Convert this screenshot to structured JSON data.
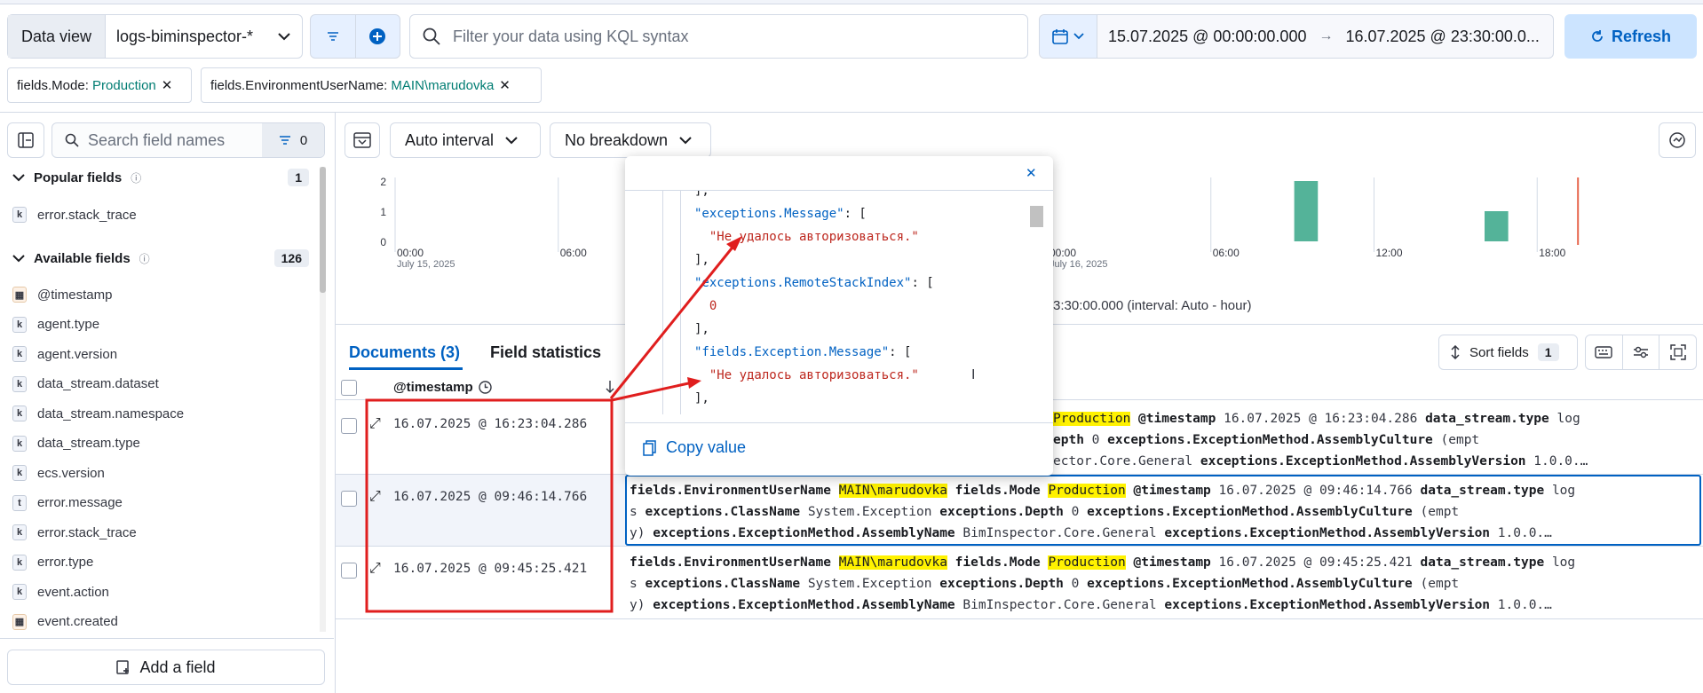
{
  "header": {
    "data_view_label": "Data view",
    "data_view_value": "logs-biminspector-*",
    "kql_placeholder": "Filter your data using KQL syntax",
    "date_start": "15.07.2025 @ 00:00:00.000",
    "date_end": "16.07.2025 @ 23:30:00.0...",
    "refresh_label": "Refresh"
  },
  "filters": [
    {
      "key": "fields.Mode: ",
      "value": "Production"
    },
    {
      "key": "fields.EnvironmentUserName: ",
      "value": "MAIN\\marudovka"
    }
  ],
  "sidebar": {
    "search_placeholder": "Search field names",
    "filter_count": "0",
    "popular_title": "Popular fields",
    "popular_count": "1",
    "popular_items": [
      {
        "type": "k",
        "label": "error.stack_trace"
      }
    ],
    "available_title": "Available fields",
    "available_count": "126",
    "available_items": [
      {
        "type": "date",
        "label": "@timestamp"
      },
      {
        "type": "k",
        "label": "agent.type"
      },
      {
        "type": "k",
        "label": "agent.version"
      },
      {
        "type": "k",
        "label": "data_stream.dataset"
      },
      {
        "type": "k",
        "label": "data_stream.namespace"
      },
      {
        "type": "k",
        "label": "data_stream.type"
      },
      {
        "type": "k",
        "label": "ecs.version"
      },
      {
        "type": "t",
        "label": "error.message"
      },
      {
        "type": "k",
        "label": "error.stack_trace"
      },
      {
        "type": "k",
        "label": "error.type"
      },
      {
        "type": "k",
        "label": "event.action"
      },
      {
        "type": "date",
        "label": "event.created"
      }
    ],
    "add_field_label": "Add a field"
  },
  "toolbar": {
    "interval_label": "Auto interval",
    "breakdown_label": "No breakdown"
  },
  "chart_data": {
    "type": "bar",
    "ylim": [
      0,
      2
    ],
    "y_ticks": [
      "2",
      "1",
      "0"
    ],
    "x_ticks": [
      "00:00",
      "06:00",
      "00:00",
      "06:00",
      "12:00",
      "18:00"
    ],
    "x_tick_sub": [
      "July 15, 2025",
      "July 16, 2025"
    ],
    "bars": [
      {
        "time": "16.07.2025 09:00",
        "value": 2
      },
      {
        "time": "16.07.2025 16:00",
        "value": 1
      }
    ],
    "marker": "now",
    "caption": "3:30:00.000 (interval: Auto - hour)"
  },
  "tabs": {
    "documents": "Documents (3)",
    "field_stats": "Field statistics"
  },
  "table": {
    "timestamp_header": "@timestamp",
    "sort_label": "Sort fields",
    "sort_count": "1",
    "rows": [
      {
        "ts": "16.07.2025 @ 16:23:04.286",
        "l1": [
          "Production",
          "@timestamp",
          "16.07.2025 @ 16:23:04.286",
          "data_stream.type",
          "log"
        ],
        "l2": [
          "epth",
          "0",
          "exceptions.ExceptionMethod.AssemblyCulture",
          "(empt"
        ],
        "l3": [
          "ector.Core.General",
          "exceptions.ExceptionMethod.AssemblyVersion",
          "1.0.0.…"
        ]
      },
      {
        "ts": "16.07.2025 @ 09:46:14.766"
      },
      {
        "ts": "16.07.2025 @ 09:45:25.421"
      }
    ],
    "full_rows": [
      {
        "user": "MAIN\\marudovka",
        "mode": "Production",
        "ts": "16.07.2025 @ 09:46:14.766"
      },
      {
        "user": "MAIN\\marudovka",
        "mode": "Production",
        "ts": "16.07.2025 @ 09:45:25.421"
      }
    ],
    "labels": {
      "env_user": "fields.EnvironmentUserName",
      "mode": "fields.Mode",
      "timestamp": "@timestamp",
      "dst": "data_stream.type",
      "log": "log",
      "log_wrap": "s",
      "class": "exceptions.ClassName",
      "class_val": "System.Exception",
      "depth": "exceptions.Depth",
      "depth_val": "0",
      "culture": "exceptions.ExceptionMethod.AssemblyCulture",
      "empt": "(empt",
      "empt_wrap": "y)",
      "asm": "exceptions.ExceptionMethod.AssemblyName",
      "asm_val": "BimInspector.Core.General",
      "ver": "exceptions.ExceptionMethod.AssemblyVersion",
      "ver_val": "1.0.0.…"
    }
  },
  "popup": {
    "lines": [
      {
        "p": "],"
      },
      {
        "k": "\"exceptions.Message\"",
        "p": ": ["
      },
      {
        "s": "\"Не удалось авторизоваться.\""
      },
      {
        "p": "],"
      },
      {
        "k": "\"exceptions.RemoteStackIndex\"",
        "p": ": ["
      },
      {
        "n": "0"
      },
      {
        "p": "],"
      },
      {
        "k": "\"fields.Exception.Message\"",
        "p": ": ["
      },
      {
        "s": "\"Не удалось авторизоваться.\""
      },
      {
        "p": "],"
      }
    ],
    "copy_label": "Copy value"
  }
}
